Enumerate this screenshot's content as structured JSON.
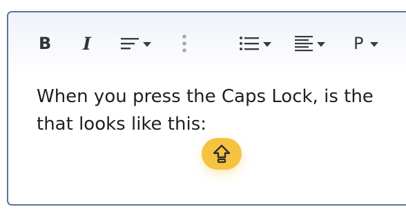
{
  "toolbar": {
    "bold_label": "B",
    "italic_label": "I",
    "paragraph_label": "P",
    "icons": [
      "align-left-icon",
      "more-vertical-icon",
      "bullet-list-icon",
      "justify-icon",
      "caps-lock-icon"
    ]
  },
  "editor": {
    "line1": "When you press the Caps Lock, is the",
    "line2": "that looks like this:"
  },
  "colors": {
    "border": "#5a7396",
    "capslock_badge": "#f5c242",
    "text": "#1f1f1f"
  }
}
